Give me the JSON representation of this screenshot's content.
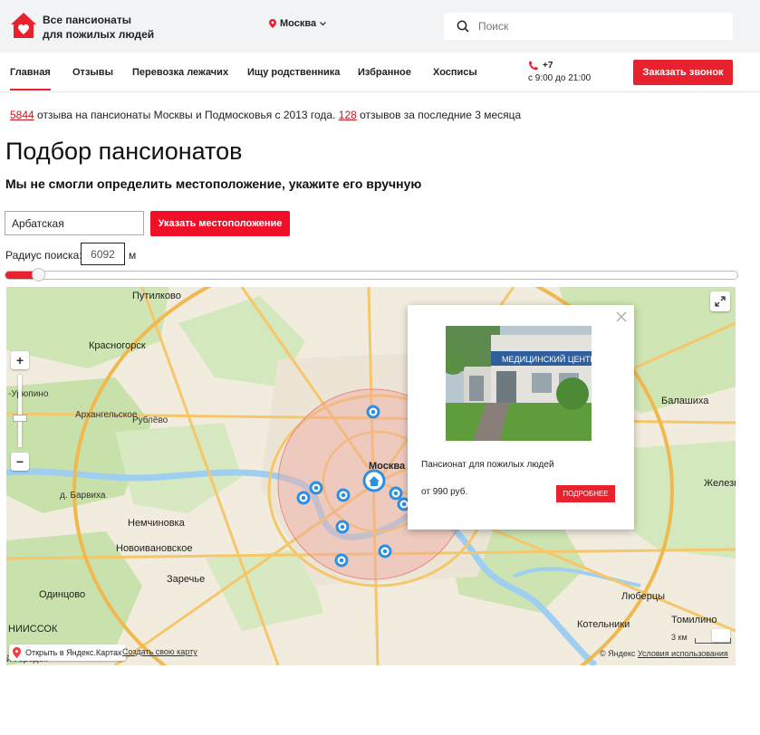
{
  "header": {
    "logo_line1": "Все пансионаты",
    "logo_line2": "для пожилых людей",
    "city": "Москва",
    "search_placeholder": "Поиск"
  },
  "nav": {
    "items": [
      {
        "label": "Главная",
        "active": true
      },
      {
        "label": "Отзывы"
      },
      {
        "label": "Перевозка лежачих"
      },
      {
        "label": "Ищу родственника"
      },
      {
        "label": "Избранное"
      },
      {
        "label": "Хосписы"
      }
    ],
    "phone": "+7",
    "hours": "с 9:00 до 21:00",
    "call_button": "Заказать звонок"
  },
  "reviews": {
    "count_total": "5844",
    "text1": " отзыва на пансионаты Москвы и Подмосковья с 2013 года. ",
    "count_recent": "128",
    "text2": " отзывов за последние 3 месяца"
  },
  "page": {
    "title": "Подбор пансионатов",
    "subtitle": "Мы не смогли определить местоположение, укажите его вручную"
  },
  "location": {
    "address_value": "Арбатская",
    "button": "Указать местоположение",
    "radius_label": "Радиус поиска:",
    "radius_value": "6092",
    "radius_unit": "м",
    "slider_fraction": 0.045
  },
  "map": {
    "places": {
      "putilkovo": "Путилково",
      "krasnogorsk": "Красногорск",
      "arkhangelskoe": "Архангельское",
      "rublevo": "Рублёво",
      "barvikha": "д. Барвиха",
      "nemchinovka": "Немчиновка",
      "novoivanovskoe": "Новоивановское",
      "zarechye": "Заречье",
      "odintsovo": "Одинцово",
      "niissok": "НИИССОК",
      "moskva": "Москва",
      "balashikha": "Балашиха",
      "zhelez": "Железн",
      "lyubertsy": "Люберцы",
      "kotelniki": "Котельники",
      "tomilino": "Томилино",
      "ururino": "-Урюпино",
      "gorodok": "й Городок"
    },
    "scale_label": "3 км",
    "open_in_yandex": "Открыть в Яндекс.Картах",
    "create_map": "Создать свою карту",
    "copyright": "© Яндекс ",
    "terms": "Условия использования",
    "popup": {
      "title": "Пансионат для пожилых людей",
      "price": "от 990 руб.",
      "button": "ПОДРОБНЕЕ",
      "sign_text": "МЕДИЦИНСКИЙ ЦЕНТР"
    },
    "colors": {
      "radius_fill": "#f2a9a2",
      "marker": "#2d8fe0",
      "accent": "#e8212e"
    }
  }
}
